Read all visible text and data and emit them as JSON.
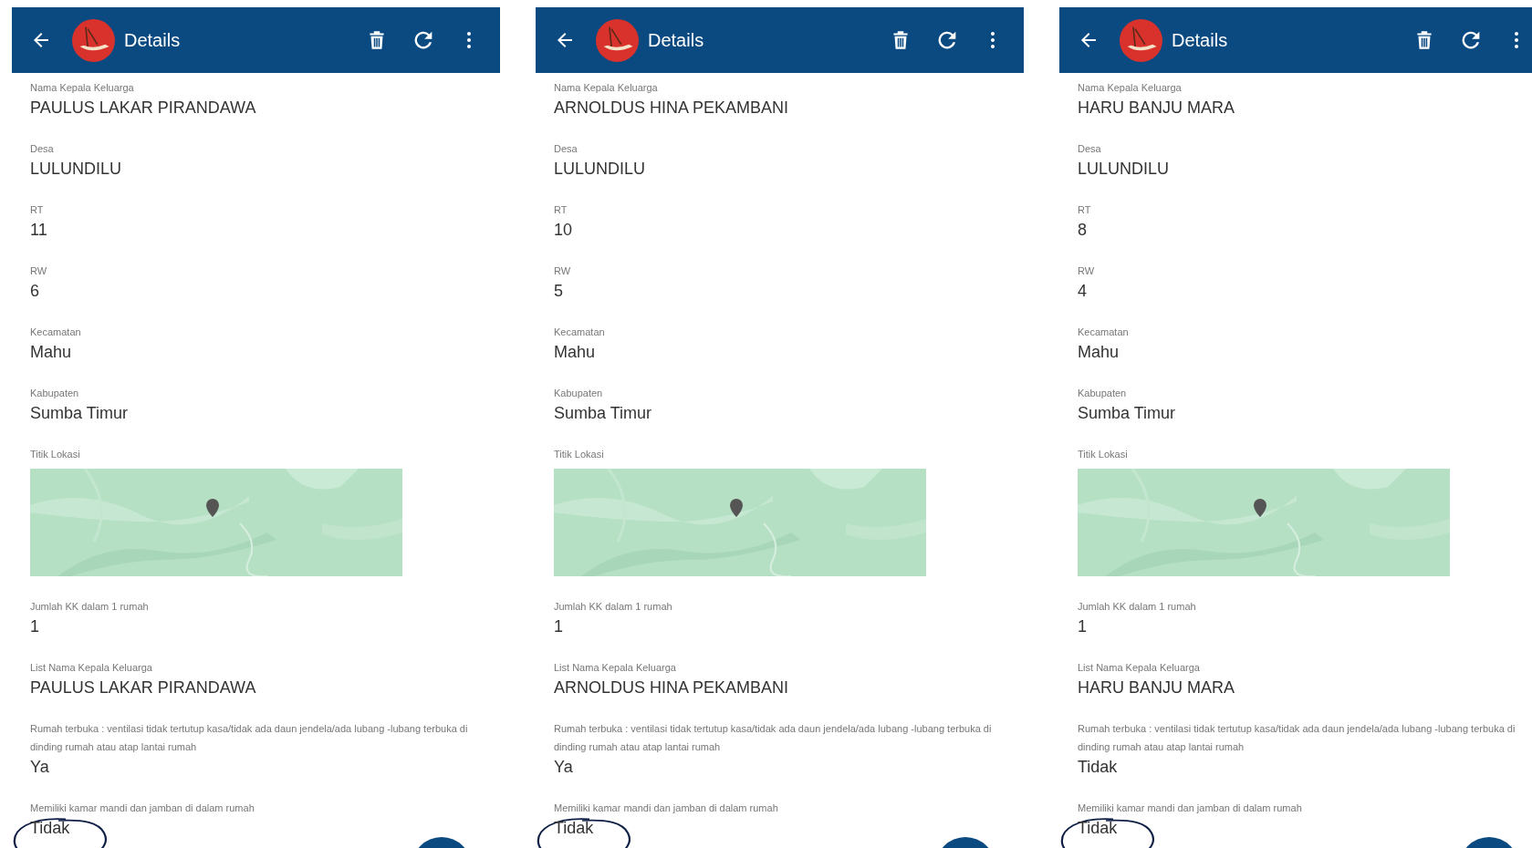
{
  "panels": [
    {
      "title": "Details",
      "fields": [
        {
          "kind": "text",
          "label": "Nama Kepala Keluarga",
          "value": "PAULUS LAKAR PIRANDAWA",
          "circled": false
        },
        {
          "kind": "text",
          "label": "Desa",
          "value": "LULUNDILU",
          "circled": false
        },
        {
          "kind": "text",
          "label": "RT",
          "value": "11",
          "circled": false
        },
        {
          "kind": "text",
          "label": "RW",
          "value": "6",
          "circled": false
        },
        {
          "kind": "text",
          "label": "Kecamatan",
          "value": "Mahu",
          "circled": false
        },
        {
          "kind": "text",
          "label": "Kabupaten",
          "value": "Sumba Timur",
          "circled": false
        },
        {
          "kind": "map",
          "label": "Titik Lokasi",
          "circled": false
        },
        {
          "kind": "text",
          "label": "Jumlah KK dalam 1 rumah",
          "value": "1",
          "circled": false
        },
        {
          "kind": "text",
          "label": "List Nama Kepala Keluarga",
          "value": "PAULUS LAKAR PIRANDAWA",
          "circled": false
        },
        {
          "kind": "text",
          "label": "Rumah terbuka : ventilasi tidak tertutup kasa/tidak ada daun jendela/ada lubang -lubang terbuka di dinding rumah atau atap lantai rumah",
          "value": "Ya",
          "circled": false
        },
        {
          "kind": "text",
          "label": "Memiliki kamar mandi dan jamban di dalam rumah",
          "value": "Tidak",
          "circled": true
        }
      ]
    },
    {
      "title": "Details",
      "fields": [
        {
          "kind": "text",
          "label": "Nama Kepala Keluarga",
          "value": "ARNOLDUS HINA PEKAMBANI",
          "circled": false
        },
        {
          "kind": "text",
          "label": "Desa",
          "value": "LULUNDILU",
          "circled": false
        },
        {
          "kind": "text",
          "label": "RT",
          "value": "10",
          "circled": false
        },
        {
          "kind": "text",
          "label": "RW",
          "value": "5",
          "circled": false
        },
        {
          "kind": "text",
          "label": "Kecamatan",
          "value": "Mahu",
          "circled": false
        },
        {
          "kind": "text",
          "label": "Kabupaten",
          "value": "Sumba Timur",
          "circled": false
        },
        {
          "kind": "map",
          "label": "Titik Lokasi",
          "circled": false
        },
        {
          "kind": "text",
          "label": "Jumlah KK dalam 1 rumah",
          "value": "1",
          "circled": false
        },
        {
          "kind": "text",
          "label": "List Nama Kepala Keluarga",
          "value": "ARNOLDUS HINA PEKAMBANI",
          "circled": false
        },
        {
          "kind": "text",
          "label": "Rumah terbuka : ventilasi tidak tertutup kasa/tidak ada daun jendela/ada lubang -lubang terbuka di dinding rumah atau atap lantai rumah",
          "value": "Ya",
          "circled": false
        },
        {
          "kind": "text",
          "label": "Memiliki kamar mandi dan jamban di dalam rumah",
          "value": "Tidak",
          "circled": true
        }
      ]
    },
    {
      "title": "Details",
      "fields": [
        {
          "kind": "text",
          "label": "Nama Kepala Keluarga",
          "value": "HARU BANJU MARA",
          "circled": false
        },
        {
          "kind": "text",
          "label": "Desa",
          "value": "LULUNDILU",
          "circled": false
        },
        {
          "kind": "text",
          "label": "RT",
          "value": "8",
          "circled": false
        },
        {
          "kind": "text",
          "label": "RW",
          "value": "4",
          "circled": false
        },
        {
          "kind": "text",
          "label": "Kecamatan",
          "value": "Mahu",
          "circled": false
        },
        {
          "kind": "text",
          "label": "Kabupaten",
          "value": "Sumba Timur",
          "circled": false
        },
        {
          "kind": "map",
          "label": "Titik Lokasi",
          "circled": false
        },
        {
          "kind": "text",
          "label": "Jumlah KK dalam 1 rumah",
          "value": "1",
          "circled": false
        },
        {
          "kind": "text",
          "label": "List Nama Kepala Keluarga",
          "value": "HARU BANJU MARA",
          "circled": false
        },
        {
          "kind": "text",
          "label": "Rumah terbuka : ventilasi tidak tertutup kasa/tidak ada daun jendela/ada lubang -lubang terbuka di dinding rumah atau atap lantai rumah",
          "value": "Tidak",
          "circled": false
        },
        {
          "kind": "text",
          "label": "Memiliki kamar mandi dan jamban di dalam rumah",
          "value": "Tidak",
          "circled": true
        }
      ]
    }
  ]
}
